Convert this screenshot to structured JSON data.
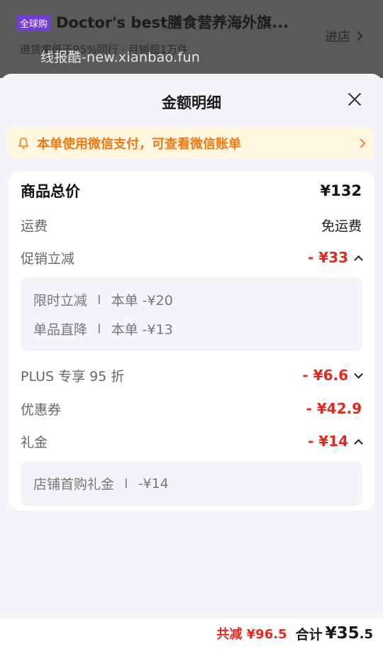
{
  "store": {
    "badge": "全球购",
    "name": "Doctor's best膳食营养海外旗...",
    "meta": "退货率低于95%同行 · 月销超1万件",
    "enter": "进店",
    "watermark": "线报酷-new.xianbao.fun"
  },
  "sheet": {
    "title": "金额明细",
    "notice": "本单使用微信支付，可查看微信账单"
  },
  "rows": {
    "total": {
      "label": "商品总价",
      "value": "¥132"
    },
    "shipping": {
      "label": "运费",
      "value": "免运费"
    },
    "promo": {
      "label": "促销立减",
      "value": "- ¥33"
    },
    "plus": {
      "label": "PLUS 专享 95 折",
      "value": "- ¥6.6"
    },
    "coupon": {
      "label": "优惠券",
      "value": "- ¥42.9"
    },
    "gift": {
      "label": "礼金",
      "value": "- ¥14"
    }
  },
  "promo_details": [
    {
      "name": "限时立减",
      "sep": "I",
      "amount": "本单 -¥20"
    },
    {
      "name": "单品直降",
      "sep": "I",
      "amount": "本单 -¥13"
    }
  ],
  "gift_details": [
    {
      "name": "店铺首购礼金",
      "sep": "I",
      "amount": "-¥14"
    }
  ],
  "footer": {
    "discount": "共减 ¥96.5",
    "total_label": "合计",
    "total_main": "¥35",
    "total_decimal": ".5"
  }
}
